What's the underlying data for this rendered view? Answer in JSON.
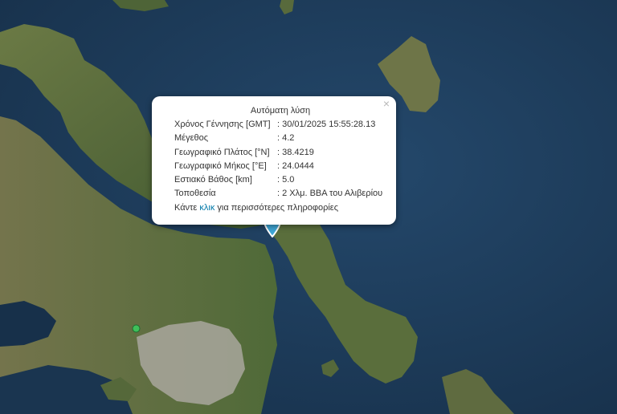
{
  "map": {
    "colors": {
      "sea": "#1d3a57",
      "land": "#5a6b3a",
      "urban": "#a9a79e",
      "marker": "#3fa7d6",
      "poi": "#3fbf5a"
    },
    "icons": {
      "marker": "map-marker-icon",
      "poi": "green-dot-icon",
      "close": "close-icon"
    }
  },
  "popup": {
    "title": "Αυτόματη λύση",
    "close_symbol": "×",
    "rows": [
      {
        "label": "Χρόνος Γέννησης [GMT]",
        "value": "30/01/2025 15:55:28.13"
      },
      {
        "label": "Μέγεθος",
        "value": "4.2"
      },
      {
        "label": "Γεωγραφικό Πλάτος [°N]",
        "value": "38.4219"
      },
      {
        "label": "Γεωγραφικό Μήκος [°E]",
        "value": "24.0444"
      },
      {
        "label": "Εστιακό Βάθος [km]",
        "value": "5.0"
      },
      {
        "label": "Τοποθεσία",
        "value": "2 Χλμ. ΒΒΑ του Αλιβερίου"
      }
    ],
    "footer": {
      "before": "Κάντε",
      "link": "κλικ",
      "after": "για περισσότερες πληροφορίες"
    }
  }
}
